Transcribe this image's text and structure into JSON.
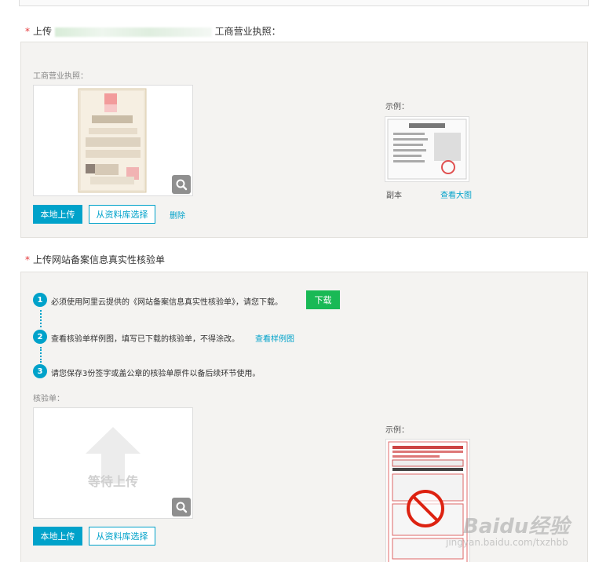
{
  "section1": {
    "title_prefix": "上传",
    "title_suffix": "工商营业执照：",
    "field_label": "工商营业执照：",
    "upload_label": "本地上传",
    "library_label": "从资料库选择",
    "delete_label": "删除",
    "example_label": "示例：",
    "example_caption": "副本",
    "example_link": "查看大图"
  },
  "section2": {
    "title_prefix": "上传网站备案信息真实性核验单",
    "steps": [
      {
        "num": "1",
        "text": "必须使用阿里云提供的《网站备案信息真实性核验单》，请您下载。"
      },
      {
        "num": "2",
        "text": "查看核验单样例图，填写已下载的核验单，不得涂改。"
      },
      {
        "num": "3",
        "text": "请您保存3份签字或盖公章的核验单原件以备后续环节使用。"
      }
    ],
    "download_label": "下载",
    "view_sample_link": "查看样例图",
    "field_label": "核验单：",
    "placeholder_text": "等待上传",
    "upload_label": "本地上传",
    "library_label": "从资料库选择",
    "example_label": "示例："
  },
  "watermark": {
    "brand": "Baidu经验",
    "url": "jingyan.baidu.com/txzhbb"
  },
  "colors": {
    "accent": "#00a2ca",
    "download": "#19b955",
    "required": "#e4393c",
    "panel": "#f4f3f1"
  }
}
